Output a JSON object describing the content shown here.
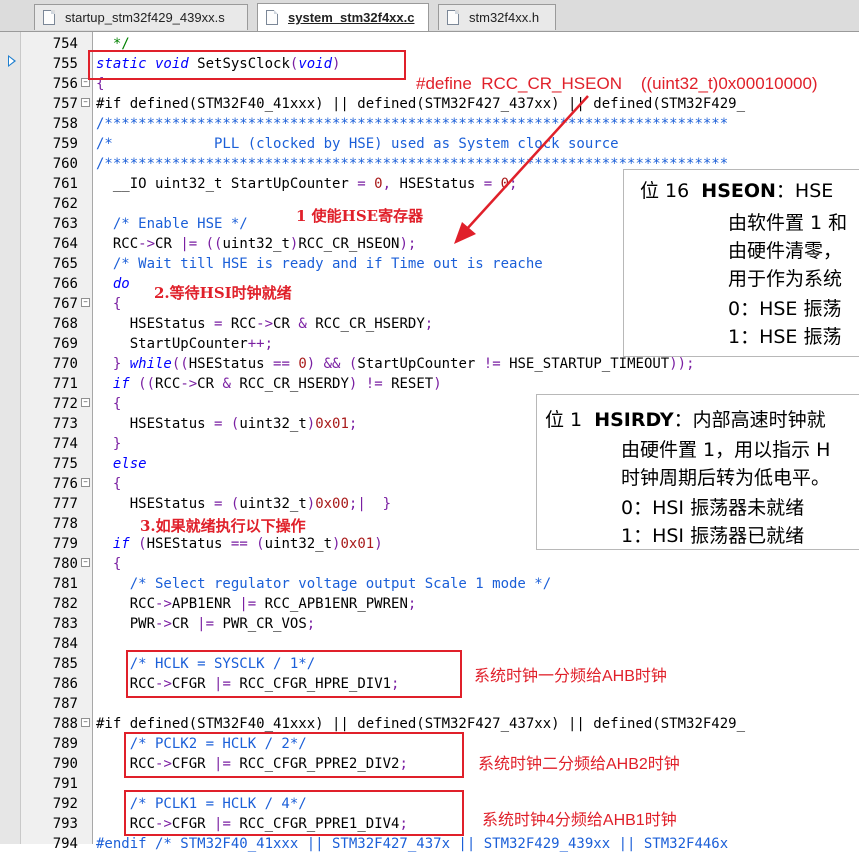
{
  "tabs": [
    {
      "label": "startup_stm32f429_439xx.s",
      "active": false
    },
    {
      "label": "system_stm32f4xx.c",
      "active": true
    },
    {
      "label": "stm32f4xx.h",
      "active": false
    }
  ],
  "lines": [
    {
      "n": "754",
      "tokens": [
        [
          "cm",
          "  */"
        ]
      ]
    },
    {
      "n": "755",
      "tokens": [
        [
          "kw",
          "static void "
        ],
        [
          "",
          "SetSysClock"
        ],
        [
          "op",
          "("
        ],
        [
          "kw",
          "void"
        ],
        [
          "op",
          ")"
        ]
      ]
    },
    {
      "n": "756",
      "tokens": [
        [
          "op",
          "{"
        ]
      ]
    },
    {
      "n": "757",
      "tokens": [
        [
          "dir",
          "#if defined(STM32F40_41xxx) || defined(STM32F427_437xx) || defined(STM32F429_"
        ]
      ]
    },
    {
      "n": "758",
      "tokens": [
        [
          "cmb",
          "/**************************************************************************"
        ]
      ]
    },
    {
      "n": "759",
      "tokens": [
        [
          "cmb",
          "/*            PLL (clocked by HSE) used as System clock source"
        ]
      ]
    },
    {
      "n": "760",
      "tokens": [
        [
          "cmb",
          "/**************************************************************************"
        ]
      ]
    },
    {
      "n": "761",
      "tokens": [
        [
          "",
          "  __IO uint32_t StartUpCounter "
        ],
        [
          "op",
          "= "
        ],
        [
          "num",
          "0"
        ],
        [
          "op",
          ", "
        ],
        [
          "",
          "HSEStatus "
        ],
        [
          "op",
          "= "
        ],
        [
          "num",
          "0"
        ],
        [
          "op",
          ";"
        ]
      ]
    },
    {
      "n": "762",
      "tokens": []
    },
    {
      "n": "763",
      "tokens": [
        [
          "cmb",
          "  /* Enable HSE */"
        ]
      ]
    },
    {
      "n": "764",
      "tokens": [
        [
          "",
          "  RCC"
        ],
        [
          "op",
          "->"
        ],
        [
          "",
          "CR "
        ],
        [
          "op",
          "|= (("
        ],
        [
          "",
          "uint32_t"
        ],
        [
          "op",
          ")"
        ],
        [
          "",
          "RCC_CR_HSEON"
        ],
        [
          "op",
          ");"
        ]
      ]
    },
    {
      "n": "765",
      "tokens": [
        [
          "cmb",
          "  /* Wait till HSE is ready and if Time out is reache"
        ]
      ]
    },
    {
      "n": "766",
      "tokens": [
        [
          "kw",
          "  do"
        ]
      ]
    },
    {
      "n": "767",
      "tokens": [
        [
          "op",
          "  {"
        ]
      ]
    },
    {
      "n": "768",
      "tokens": [
        [
          "",
          "    HSEStatus "
        ],
        [
          "op",
          "= "
        ],
        [
          "",
          "RCC"
        ],
        [
          "op",
          "->"
        ],
        [
          "",
          "CR "
        ],
        [
          "op",
          "& "
        ],
        [
          "",
          "RCC_CR_HSERDY"
        ],
        [
          "op",
          ";"
        ]
      ]
    },
    {
      "n": "769",
      "tokens": [
        [
          "",
          "    StartUpCounter"
        ],
        [
          "op",
          "++;"
        ]
      ]
    },
    {
      "n": "770",
      "tokens": [
        [
          "op",
          "  } "
        ],
        [
          "kw",
          "while"
        ],
        [
          "op",
          "(("
        ],
        [
          "",
          "HSEStatus "
        ],
        [
          "op",
          "== "
        ],
        [
          "num",
          "0"
        ],
        [
          "op",
          ") && ("
        ],
        [
          "",
          "StartUpCounter "
        ],
        [
          "op",
          "!= "
        ],
        [
          "",
          "HSE_STARTUP_TIMEOUT"
        ],
        [
          "op",
          "));"
        ]
      ]
    },
    {
      "n": "771",
      "tokens": [
        [
          "kw",
          "  if "
        ],
        [
          "op",
          "(("
        ],
        [
          "",
          "RCC"
        ],
        [
          "op",
          "->"
        ],
        [
          "",
          "CR "
        ],
        [
          "op",
          "& "
        ],
        [
          "",
          "RCC_CR_HSERDY"
        ],
        [
          "op",
          ") != "
        ],
        [
          "",
          "RESET"
        ],
        [
          "op",
          ")"
        ]
      ]
    },
    {
      "n": "772",
      "tokens": [
        [
          "op",
          "  {"
        ]
      ]
    },
    {
      "n": "773",
      "tokens": [
        [
          "",
          "    HSEStatus "
        ],
        [
          "op",
          "= ("
        ],
        [
          "",
          "uint32_t"
        ],
        [
          "op",
          ")"
        ],
        [
          "num",
          "0x01"
        ],
        [
          "op",
          ";"
        ]
      ]
    },
    {
      "n": "774",
      "tokens": [
        [
          "op",
          "  }"
        ]
      ]
    },
    {
      "n": "775",
      "tokens": [
        [
          "kw",
          "  else"
        ]
      ]
    },
    {
      "n": "776",
      "tokens": [
        [
          "op",
          "  {"
        ]
      ]
    },
    {
      "n": "777",
      "tokens": [
        [
          "",
          "    HSEStatus "
        ],
        [
          "op",
          "= ("
        ],
        [
          "",
          "uint32_t"
        ],
        [
          "op",
          ")"
        ],
        [
          "num",
          "0x00"
        ],
        [
          "op",
          ";|  }"
        ]
      ]
    },
    {
      "n": "778",
      "tokens": []
    },
    {
      "n": "779",
      "tokens": [
        [
          "kw",
          "  if "
        ],
        [
          "op",
          "("
        ],
        [
          "",
          "HSEStatus "
        ],
        [
          "op",
          "== ("
        ],
        [
          "",
          "uint32_t"
        ],
        [
          "op",
          ")"
        ],
        [
          "num",
          "0x01"
        ],
        [
          "op",
          ")"
        ]
      ]
    },
    {
      "n": "780",
      "tokens": [
        [
          "op",
          "  {"
        ]
      ]
    },
    {
      "n": "781",
      "tokens": [
        [
          "cmb",
          "    /* Select regulator voltage output Scale 1 mode */"
        ]
      ]
    },
    {
      "n": "782",
      "tokens": [
        [
          "",
          "    RCC"
        ],
        [
          "op",
          "->"
        ],
        [
          "",
          "APB1ENR "
        ],
        [
          "op",
          "|= "
        ],
        [
          "",
          "RCC_APB1ENR_PWREN"
        ],
        [
          "op",
          ";"
        ]
      ]
    },
    {
      "n": "783",
      "tokens": [
        [
          "",
          "    PWR"
        ],
        [
          "op",
          "->"
        ],
        [
          "",
          "CR "
        ],
        [
          "op",
          "|= "
        ],
        [
          "",
          "PWR_CR_VOS"
        ],
        [
          "op",
          ";"
        ]
      ]
    },
    {
      "n": "784",
      "tokens": []
    },
    {
      "n": "785",
      "tokens": [
        [
          "cmb",
          "    /* HCLK = SYSCLK / 1*/"
        ]
      ]
    },
    {
      "n": "786",
      "tokens": [
        [
          "",
          "    RCC"
        ],
        [
          "op",
          "->"
        ],
        [
          "",
          "CFGR "
        ],
        [
          "op",
          "|= "
        ],
        [
          "",
          "RCC_CFGR_HPRE_DIV1"
        ],
        [
          "op",
          ";"
        ]
      ]
    },
    {
      "n": "787",
      "tokens": []
    },
    {
      "n": "788",
      "tokens": [
        [
          "dir",
          "#if defined(STM32F40_41xxx) || defined(STM32F427_437xx) || defined(STM32F429_"
        ]
      ]
    },
    {
      "n": "789",
      "tokens": [
        [
          "cmb",
          "    /* PCLK2 = HCLK / 2*/"
        ]
      ]
    },
    {
      "n": "790",
      "tokens": [
        [
          "",
          "    RCC"
        ],
        [
          "op",
          "->"
        ],
        [
          "",
          "CFGR "
        ],
        [
          "op",
          "|= "
        ],
        [
          "",
          "RCC_CFGR_PPRE2_DIV2"
        ],
        [
          "op",
          ";"
        ]
      ]
    },
    {
      "n": "791",
      "tokens": []
    },
    {
      "n": "792",
      "tokens": [
        [
          "cmb",
          "    /* PCLK1 = HCLK / 4*/"
        ]
      ]
    },
    {
      "n": "793",
      "tokens": [
        [
          "",
          "    RCC"
        ],
        [
          "op",
          "->"
        ],
        [
          "",
          "CFGR "
        ],
        [
          "op",
          "|= "
        ],
        [
          "",
          "RCC_CFGR_PPRE1_DIV4"
        ],
        [
          "op",
          ";"
        ]
      ]
    },
    {
      "n": "794",
      "tokens": [
        [
          "cmb",
          "#endif /* STM32F40_41xxx || STM32F427_437x || STM32F429_439xx || STM32F446x"
        ]
      ]
    }
  ],
  "annotations": {
    "define_note": "#define  RCC_CR_HSEON    ((uint32_t)0x00010000)",
    "step1": "1 使能HSE寄存器",
    "step2": "2.等待HSI时钟就绪",
    "step3": "3.如果就绪执行以下操作",
    "ahb": "系统时钟一分频给AHB时钟",
    "ahb2": "系统时钟二分频给AHB2时钟",
    "ahb1": "系统时钟4分频给AHB1时钟"
  },
  "popup_hseon": {
    "title_prefix": "位 16  ",
    "title_bold": "HSEON",
    "title_rest": "：HSE",
    "l1": "由软件置 1 和",
    "l2": "由硬件清零，",
    "l3": "用于作为系统",
    "l4": "0：HSE 振荡",
    "l5": "1：HSE 振荡"
  },
  "popup_hsirdy": {
    "title_prefix": "位 1  ",
    "title_bold": "HSIRDY",
    "title_rest": "：内部高速时钟就",
    "l1": "由硬件置 1，用以指示 H",
    "l2": "时钟周期后转为低电平。",
    "l3": "0：HSI 振荡器未就绪",
    "l4": "1：HSI 振荡器已就绪"
  }
}
